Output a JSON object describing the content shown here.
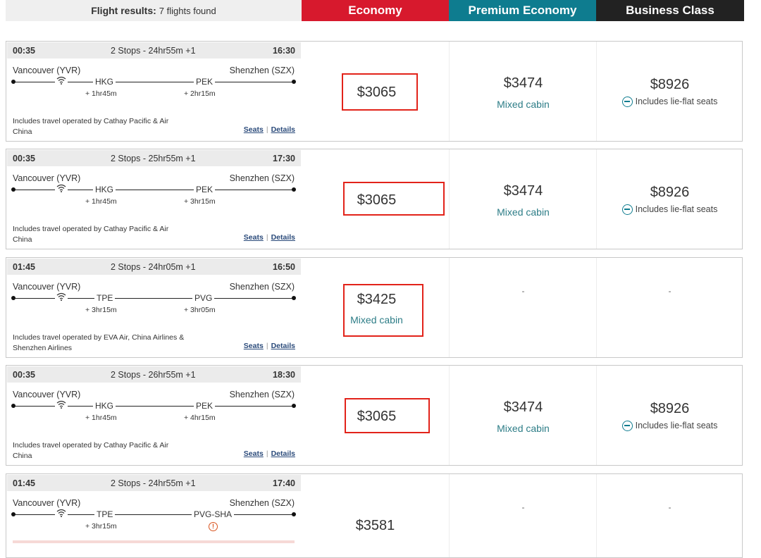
{
  "header": {
    "results_label": "Flight results:",
    "results_count": "7 flights found",
    "col_economy": "Economy",
    "col_premium": "Premium Economy",
    "col_business": "Business Class"
  },
  "links": {
    "seats": "Seats",
    "details": "Details",
    "separator": "|"
  },
  "icons": {
    "wifi": "wifi-icon",
    "lie_flat": "lie-flat-seat-icon",
    "warning": "warning-icon"
  },
  "colors": {
    "economy": "#d7192d",
    "premium": "#0e7c8f",
    "business": "#222222",
    "highlight_box": "#e2231a"
  },
  "flights": [
    {
      "dep": "00:35",
      "stops": "2 Stops - 24hr55m +1",
      "arr": "16:30",
      "from": "Vancouver (YVR)",
      "to": "Shenzhen (SZX)",
      "stop1": "HKG",
      "stop2": "PEK",
      "lay1": "+ 1hr45m",
      "lay2": "+ 2hr15m",
      "ops": "Includes travel operated by Cathay Pacific & Air China",
      "economy_price": "$3065",
      "economy_mixed": "",
      "premium_price": "$3474",
      "premium_mixed": "Mixed cabin",
      "business_price": "$8926",
      "business_note": "Includes lie-flat seats"
    },
    {
      "dep": "00:35",
      "stops": "2 Stops - 25hr55m +1",
      "arr": "17:30",
      "from": "Vancouver (YVR)",
      "to": "Shenzhen (SZX)",
      "stop1": "HKG",
      "stop2": "PEK",
      "lay1": "+ 1hr45m",
      "lay2": "+ 3hr15m",
      "ops": "Includes travel operated by Cathay Pacific & Air China",
      "economy_price": "$3065",
      "economy_mixed": "",
      "premium_price": "$3474",
      "premium_mixed": "Mixed cabin",
      "business_price": "$8926",
      "business_note": "Includes lie-flat seats"
    },
    {
      "dep": "01:45",
      "stops": "2 Stops - 24hr05m +1",
      "arr": "16:50",
      "from": "Vancouver (YVR)",
      "to": "Shenzhen (SZX)",
      "stop1": "TPE",
      "stop2": "PVG",
      "lay1": "+ 3hr15m",
      "lay2": "+ 3hr05m",
      "ops": "Includes travel operated by EVA Air, China Airlines & Shenzhen Airlines",
      "economy_price": "$3425",
      "economy_mixed": "Mixed cabin",
      "premium_price": "-",
      "premium_mixed": "",
      "business_price": "-",
      "business_note": ""
    },
    {
      "dep": "00:35",
      "stops": "2 Stops - 26hr55m +1",
      "arr": "18:30",
      "from": "Vancouver (YVR)",
      "to": "Shenzhen (SZX)",
      "stop1": "HKG",
      "stop2": "PEK",
      "lay1": "+ 1hr45m",
      "lay2": "+ 4hr15m",
      "ops": "Includes travel operated by Cathay Pacific & Air China",
      "economy_price": "$3065",
      "economy_mixed": "",
      "premium_price": "$3474",
      "premium_mixed": "Mixed cabin",
      "business_price": "$8926",
      "business_note": "Includes lie-flat seats"
    },
    {
      "dep": "01:45",
      "stops": "2 Stops - 24hr55m +1",
      "arr": "17:40",
      "from": "Vancouver (YVR)",
      "to": "Shenzhen (SZX)",
      "stop1": "TPE",
      "stop2": "PVG-SHA",
      "lay1": "+ 3hr15m",
      "lay2": "",
      "ops": "",
      "economy_price": "$3581",
      "economy_mixed": "",
      "premium_price": "-",
      "premium_mixed": "",
      "business_price": "-",
      "business_note": ""
    }
  ]
}
